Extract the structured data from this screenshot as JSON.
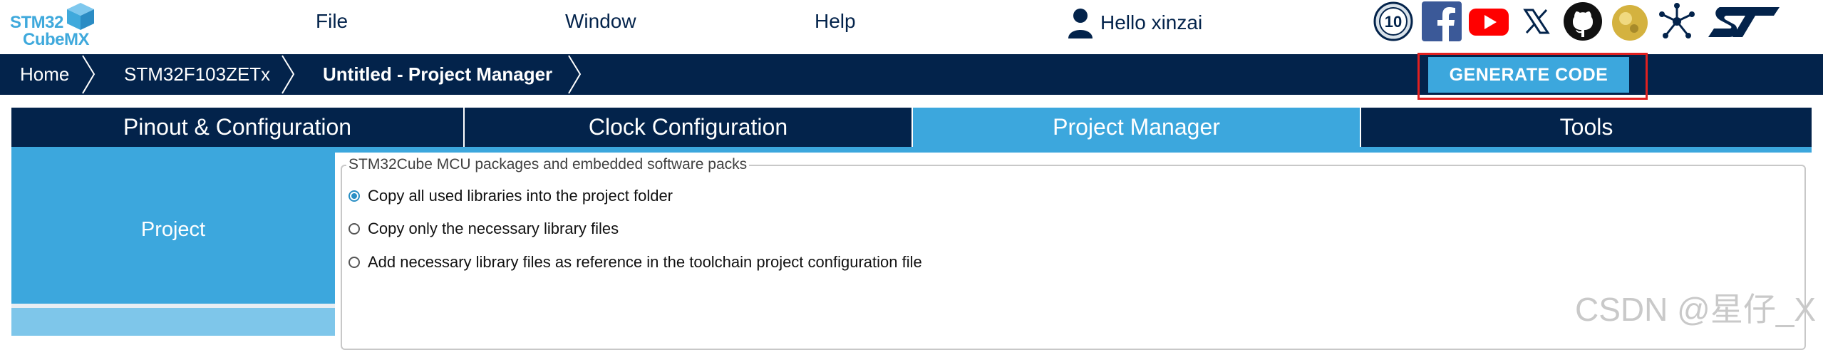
{
  "logo": {
    "line1": "STM32",
    "line2": "CubeMX"
  },
  "menu": {
    "file": "File",
    "window": "Window",
    "help": "Help"
  },
  "user": {
    "greeting": "Hello xinzai"
  },
  "social": {
    "anniversary_badge": "10",
    "icons": [
      "anniversary-icon",
      "facebook-icon",
      "youtube-icon",
      "x-icon",
      "github-icon",
      "wiki-icon",
      "network-icon",
      "st-logo-icon"
    ]
  },
  "breadcrumb": {
    "home": "Home",
    "mcu": "STM32F103ZETx",
    "current": "Untitled - Project Manager"
  },
  "toolbar": {
    "generate_label": "GENERATE CODE"
  },
  "tabs": [
    {
      "label": "Pinout & Configuration",
      "active": false
    },
    {
      "label": "Clock Configuration",
      "active": false
    },
    {
      "label": "Project Manager",
      "active": true
    },
    {
      "label": "Tools",
      "active": false
    }
  ],
  "sidebar": {
    "project_label": "Project"
  },
  "packs": {
    "legend": "STM32Cube MCU packages and embedded software packs",
    "options": [
      {
        "label": "Copy all used libraries into the project folder",
        "checked": true
      },
      {
        "label": "Copy only the necessary library files",
        "checked": false
      },
      {
        "label": "Add necessary library files as reference in the toolchain project configuration file",
        "checked": false
      }
    ]
  },
  "watermark": "CSDN @星仔_X",
  "colors": {
    "navy": "#03234b",
    "accent": "#3ca7dd",
    "highlight_box": "#e02020"
  }
}
